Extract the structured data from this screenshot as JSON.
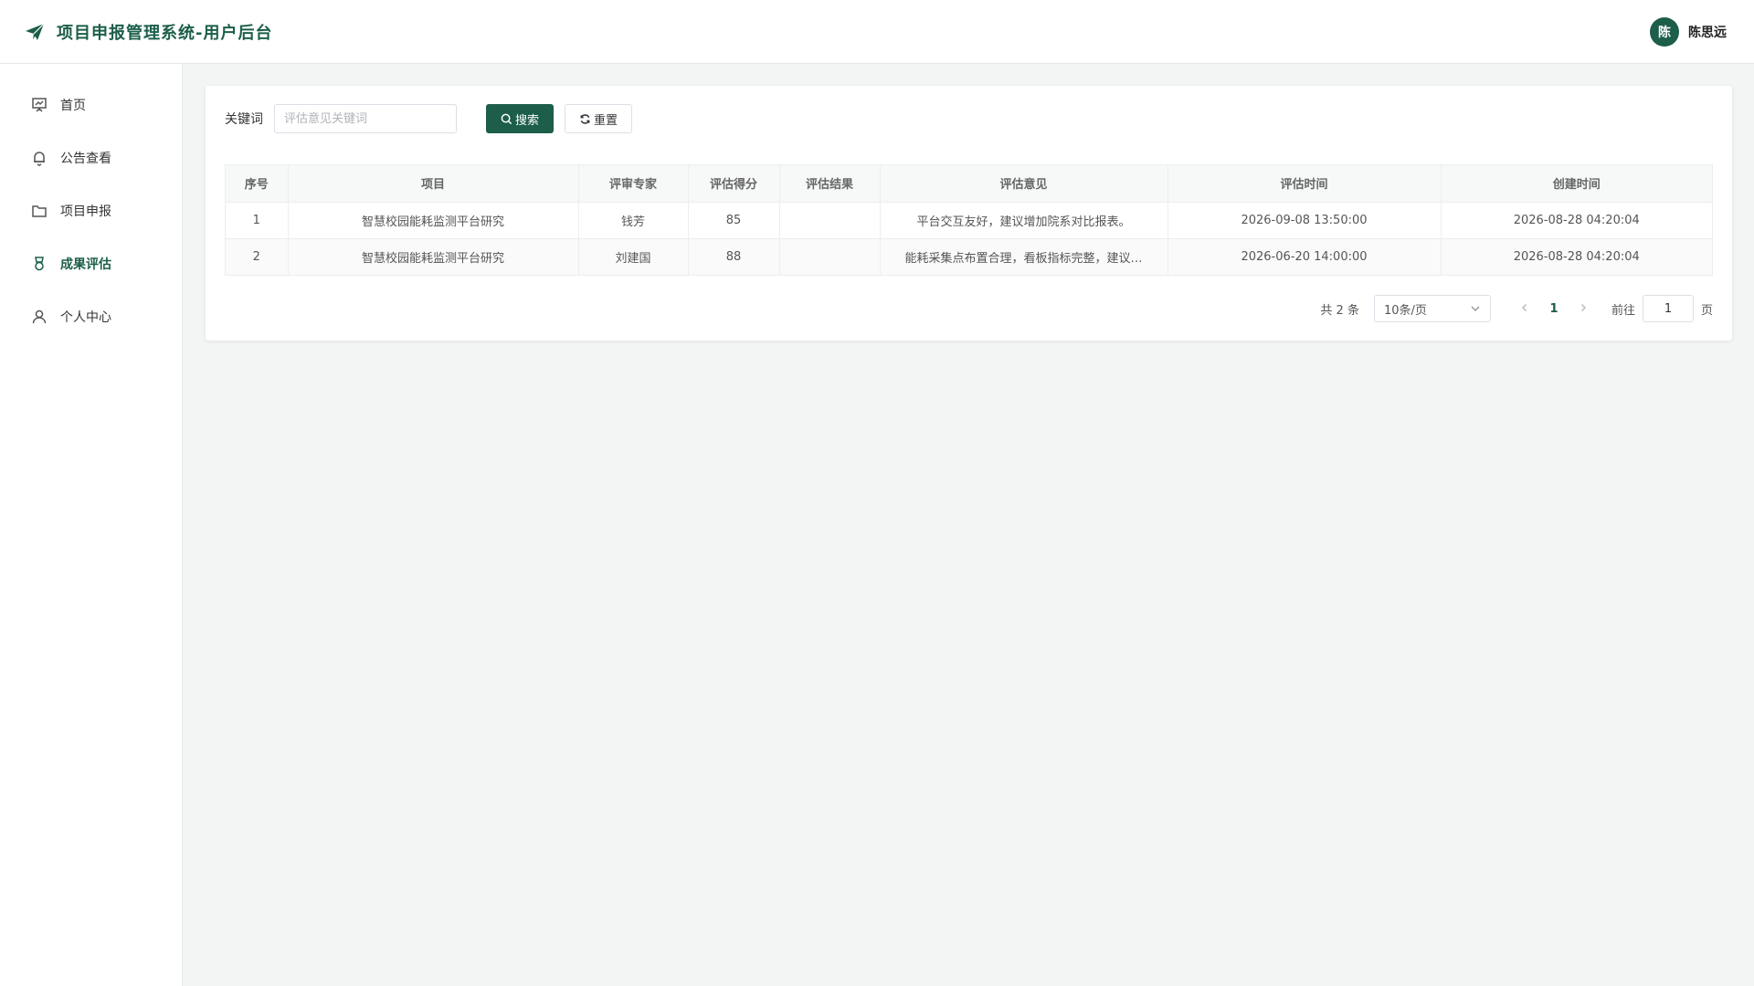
{
  "header": {
    "title": "项目申报管理系统-用户后台",
    "avatar_text": "陈",
    "username": "陈思远"
  },
  "sidebar": {
    "items": [
      {
        "label": "首页",
        "icon": "presentation-icon"
      },
      {
        "label": "公告查看",
        "icon": "bell-icon"
      },
      {
        "label": "项目申报",
        "icon": "folder-icon"
      },
      {
        "label": "成果评估",
        "icon": "medal-icon",
        "active": true
      },
      {
        "label": "个人中心",
        "icon": "user-icon"
      }
    ]
  },
  "search": {
    "label": "关键词",
    "placeholder": "评估意见关键词",
    "search_button": "搜索",
    "reset_button": "重置"
  },
  "table": {
    "headers": [
      "序号",
      "项目",
      "评审专家",
      "评估得分",
      "评估结果",
      "评估意见",
      "评估时间",
      "创建时间"
    ],
    "rows": [
      [
        "1",
        "智慧校园能耗监测平台研究",
        "钱芳",
        "85",
        "",
        "平台交互友好，建议增加院系对比报表。",
        "2026-09-08 13:50:00",
        "2026-08-28 04:20:04"
      ],
      [
        "2",
        "智慧校园能耗监测平台研究",
        "刘建国",
        "88",
        "",
        "能耗采集点布置合理，看板指标完整，建议…",
        "2026-06-20 14:00:00",
        "2026-08-28 04:20:04"
      ]
    ]
  },
  "pagination": {
    "total_text": "共 2 条",
    "page_size": "10条/页",
    "current_page": "1",
    "goto_label": "前往",
    "goto_value": "1",
    "page_suffix": "页"
  },
  "colors": {
    "primary": "#1c5e4a",
    "background": "#f2f5f4"
  }
}
